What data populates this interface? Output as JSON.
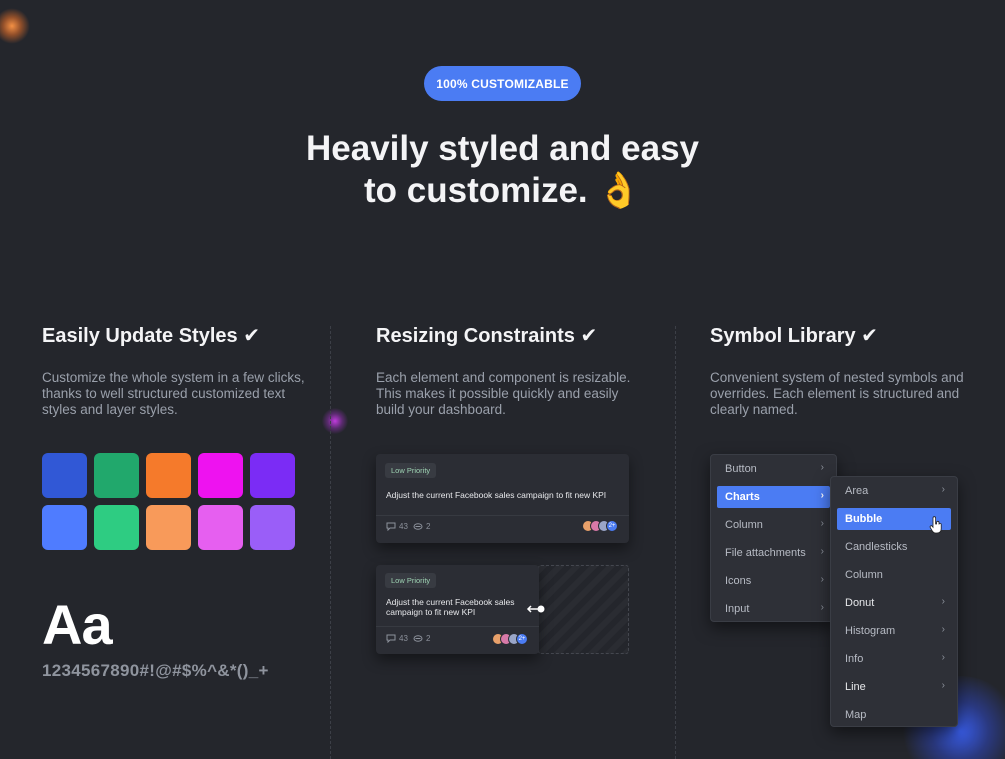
{
  "hero": {
    "badge": "100% CUSTOMIZABLE",
    "headline_line1": "Heavily styled and easy",
    "headline_line2": "to customize. 👌"
  },
  "columns": [
    {
      "title": "Easily Update Styles ✔",
      "description": "Customize the whole system in a few clicks, thanks to well structured customized text styles and layer styles."
    },
    {
      "title": "Resizing Constraints ✔",
      "description": "Each element and component is resizable. This makes it possible quickly and easily build your dashboard."
    },
    {
      "title": "Symbol Library ✔",
      "description": "Convenient system of nested symbols and overrides. Each element is structured and clearly named."
    }
  ],
  "palette": {
    "row1": [
      "#3158d6",
      "#21a86c",
      "#f57a2b",
      "#ee12f0",
      "#7b2cf5"
    ],
    "row2": [
      "#4f7cff",
      "#2ecc82",
      "#f89a5a",
      "#e65ff0",
      "#9a5ef8"
    ]
  },
  "typography": {
    "sample": "Aa",
    "characters": "1234567890#!@#$%^&*()_+"
  },
  "cards": [
    {
      "badge": "Low Priority",
      "text": "Adjust the current Facebook sales campaign to fit new KPI",
      "comments": "43",
      "attachments": "2",
      "avatars_more": "2+"
    },
    {
      "badge": "Low Priority",
      "text_line1": "Adjust the current Facebook sales",
      "text_line2": "campaign to fit new KPI",
      "comments": "43",
      "attachments": "2",
      "avatars_more": "2+"
    }
  ],
  "menu": {
    "items": [
      "Button",
      "Charts",
      "Column",
      "File attachments",
      "Icons",
      "Input"
    ],
    "active": "Charts"
  },
  "submenu": {
    "items": [
      "Area",
      "Bubble",
      "Candlesticks",
      "Column",
      "Donut",
      "Histogram",
      "Info",
      "Line",
      "Map"
    ],
    "active": "Bubble"
  },
  "colors": {
    "background": "#24262c",
    "accent": "#4b7cf3"
  }
}
